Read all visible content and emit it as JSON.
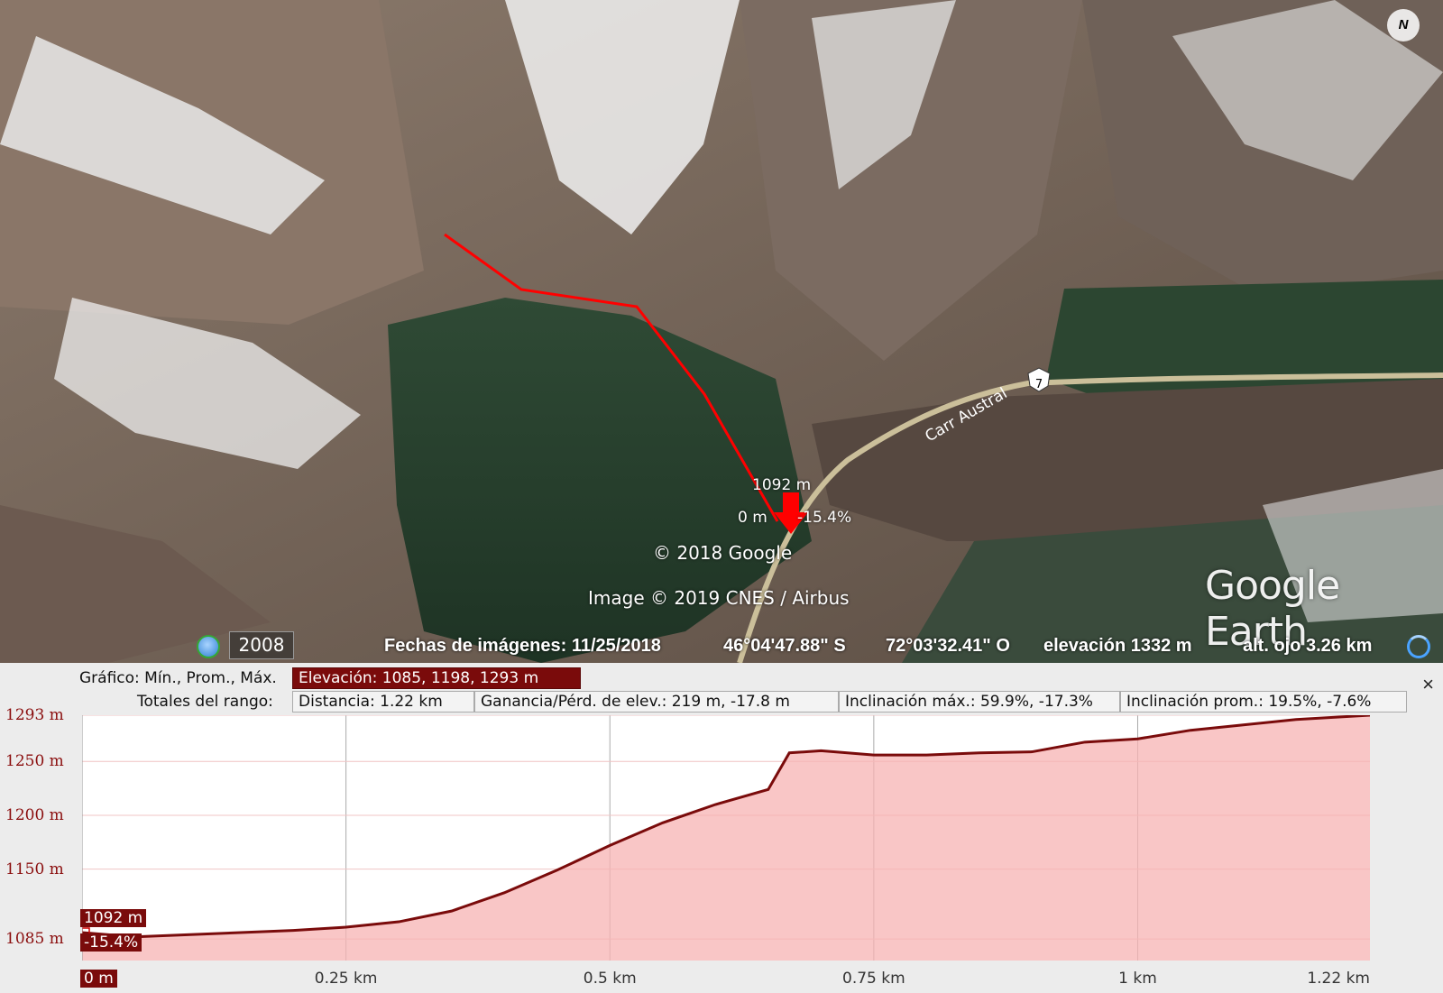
{
  "map": {
    "marker_elevation": "1092 m",
    "marker_distance": "0 m",
    "marker_slope": "-15.4%",
    "road_label": "Carr Austral",
    "road_shield": "7",
    "copyright": "© 2018 Google",
    "image_credit": "Image © 2019 CNES / Airbus",
    "logo": "Google Earth",
    "north_label": "N"
  },
  "status": {
    "historical_year": "2008",
    "imagery_dates": "Fechas de imágenes: 11/25/2018",
    "latitude": "46°04'47.88\" S",
    "longitude": "72°03'32.41\" O",
    "elevation": "elevación  1332 m",
    "eye_altitude": "alt. ojo   3.26 km"
  },
  "profile_header": {
    "graph_label": "Gráfico: Mín., Prom., Máx.",
    "graph_value": "Elevación: 1085, 1198, 1293 m",
    "totals_label": "Totales del rango:",
    "distance": "Distancia: 1.22 km",
    "gain_loss": "Ganancia/Pérd. de elev.: 219 m, -17.8 m",
    "max_slope": "Inclinación máx.: 59.9%, -17.3%",
    "avg_slope": "Inclinación prom.: 19.5%, -7.6%",
    "close": "×"
  },
  "cursor": {
    "elevation": "1092 m",
    "slope": "-15.4%"
  },
  "colors": {
    "accent": "#7a0b0b",
    "route": "#ff0000",
    "profile_fill": "#f7b3b3",
    "profile_line": "#7a0b0b"
  },
  "chart_data": {
    "type": "area",
    "title": "",
    "xlabel": "",
    "ylabel": "",
    "x_tick_labels": [
      "0 m",
      "0.25 km",
      "0.5 km",
      "0.75 km",
      "1 km",
      "1.22 km"
    ],
    "y_tick_labels": [
      "1293 m",
      "1250 m",
      "1200 m",
      "1150 m",
      "1085 m"
    ],
    "y_ticks": [
      1293,
      1250,
      1200,
      1150,
      1085
    ],
    "xlim": [
      0,
      1.22
    ],
    "ylim": [
      1065,
      1293
    ],
    "series": [
      {
        "x": [
          0,
          0.05,
          0.1,
          0.15,
          0.2,
          0.25,
          0.3,
          0.35,
          0.4,
          0.45,
          0.5,
          0.55,
          0.6,
          0.65,
          0.67,
          0.7,
          0.75,
          0.8,
          0.85,
          0.9,
          0.95,
          1.0,
          1.05,
          1.1,
          1.15,
          1.22
        ],
        "y": [
          1091,
          1087,
          1089,
          1091,
          1093,
          1096,
          1101,
          1111,
          1128,
          1149,
          1172,
          1193,
          1210,
          1224,
          1258,
          1260,
          1256,
          1256,
          1258,
          1259,
          1268,
          1271,
          1279,
          1284,
          1289,
          1293
        ]
      }
    ]
  }
}
